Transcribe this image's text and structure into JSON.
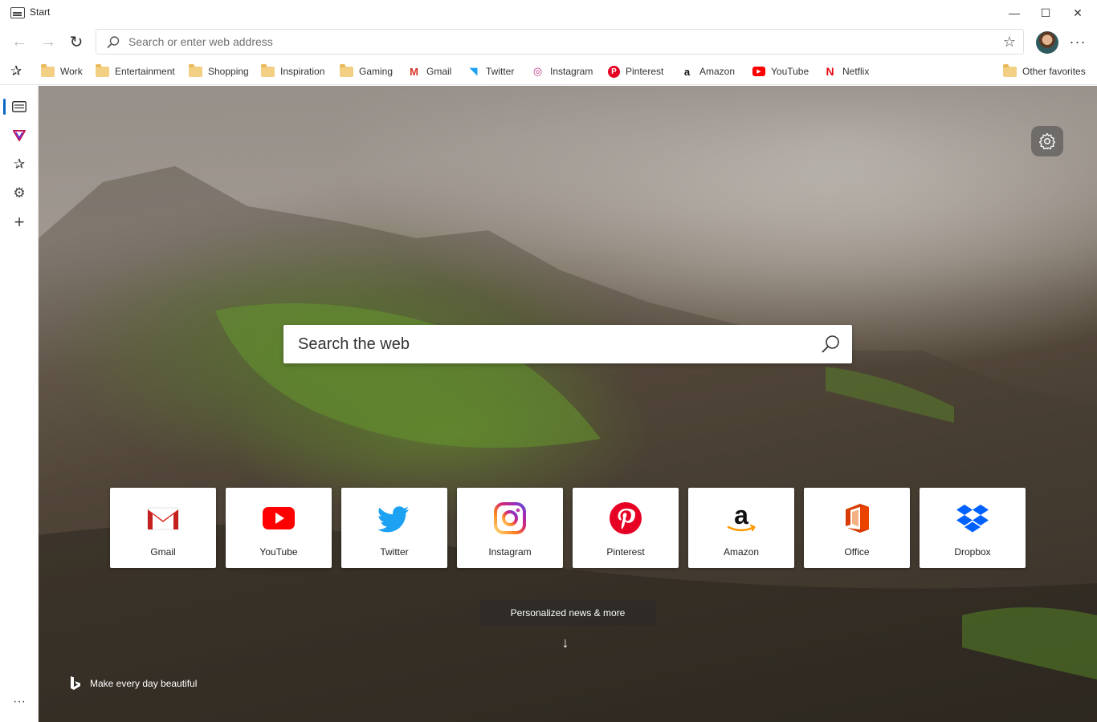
{
  "window": {
    "title": "Start",
    "minimize": "—",
    "maximize": "☐",
    "close": "✕"
  },
  "nav": {
    "back": "←",
    "forward": "→",
    "refresh": "↻",
    "address_placeholder": "Search or enter web address",
    "favorite_star": "☆",
    "more": "···"
  },
  "favorites": {
    "hub_icon": "✰",
    "items": [
      {
        "label": "Work",
        "icon": "folder-icon"
      },
      {
        "label": "Entertainment",
        "icon": "folder-icon"
      },
      {
        "label": "Shopping",
        "icon": "folder-icon"
      },
      {
        "label": "Inspiration",
        "icon": "folder-icon"
      },
      {
        "label": "Gaming",
        "icon": "folder-icon"
      },
      {
        "label": "Gmail",
        "icon": "gmail-icon",
        "glyph": "M",
        "color": "#d93025"
      },
      {
        "label": "Twitter",
        "icon": "twitter-icon",
        "glyph": "◥",
        "color": "#1da1f2"
      },
      {
        "label": "Instagram",
        "icon": "instagram-icon",
        "glyph": "◎",
        "color": "#c13584"
      },
      {
        "label": "Pinterest",
        "icon": "pinterest-icon",
        "glyph": "P",
        "color": "#e60023"
      },
      {
        "label": "Amazon",
        "icon": "amazon-icon",
        "glyph": "a",
        "color": "#111111"
      },
      {
        "label": "YouTube",
        "icon": "youtube-icon",
        "glyph": "▶",
        "color": "#ff0000"
      },
      {
        "label": "Netflix",
        "icon": "netflix-icon",
        "glyph": "N",
        "color": "#e50914"
      }
    ],
    "other": "Other favorites"
  },
  "sidebar": {
    "items": [
      {
        "icon": "tabs-icon"
      },
      {
        "icon": "vivaldi-icon"
      },
      {
        "icon": "favorites-icon",
        "glyph": "✰"
      },
      {
        "icon": "settings-icon",
        "glyph": "⚙"
      },
      {
        "icon": "add-icon",
        "glyph": "+"
      }
    ],
    "more": "···"
  },
  "newtab": {
    "search_placeholder": "Search the web",
    "tiles": [
      {
        "label": "Gmail",
        "icon": "gmail-icon"
      },
      {
        "label": "YouTube",
        "icon": "youtube-icon"
      },
      {
        "label": "Twitter",
        "icon": "twitter-icon"
      },
      {
        "label": "Instagram",
        "icon": "instagram-icon"
      },
      {
        "label": "Pinterest",
        "icon": "pinterest-icon"
      },
      {
        "label": "Amazon",
        "icon": "amazon-icon"
      },
      {
        "label": "Office",
        "icon": "office-icon"
      },
      {
        "label": "Dropbox",
        "icon": "dropbox-icon"
      }
    ],
    "news_button": "Personalized news & more",
    "news_arrow": "↓",
    "bing_tagline": "Make every day beautiful"
  },
  "colors": {
    "accent": "#0a66c2",
    "gmail": "#d93025",
    "youtube": "#ff0000",
    "twitter": "#1da1f2",
    "pinterest": "#e60023",
    "dropbox": "#0061fe",
    "office": "#d83b01"
  }
}
